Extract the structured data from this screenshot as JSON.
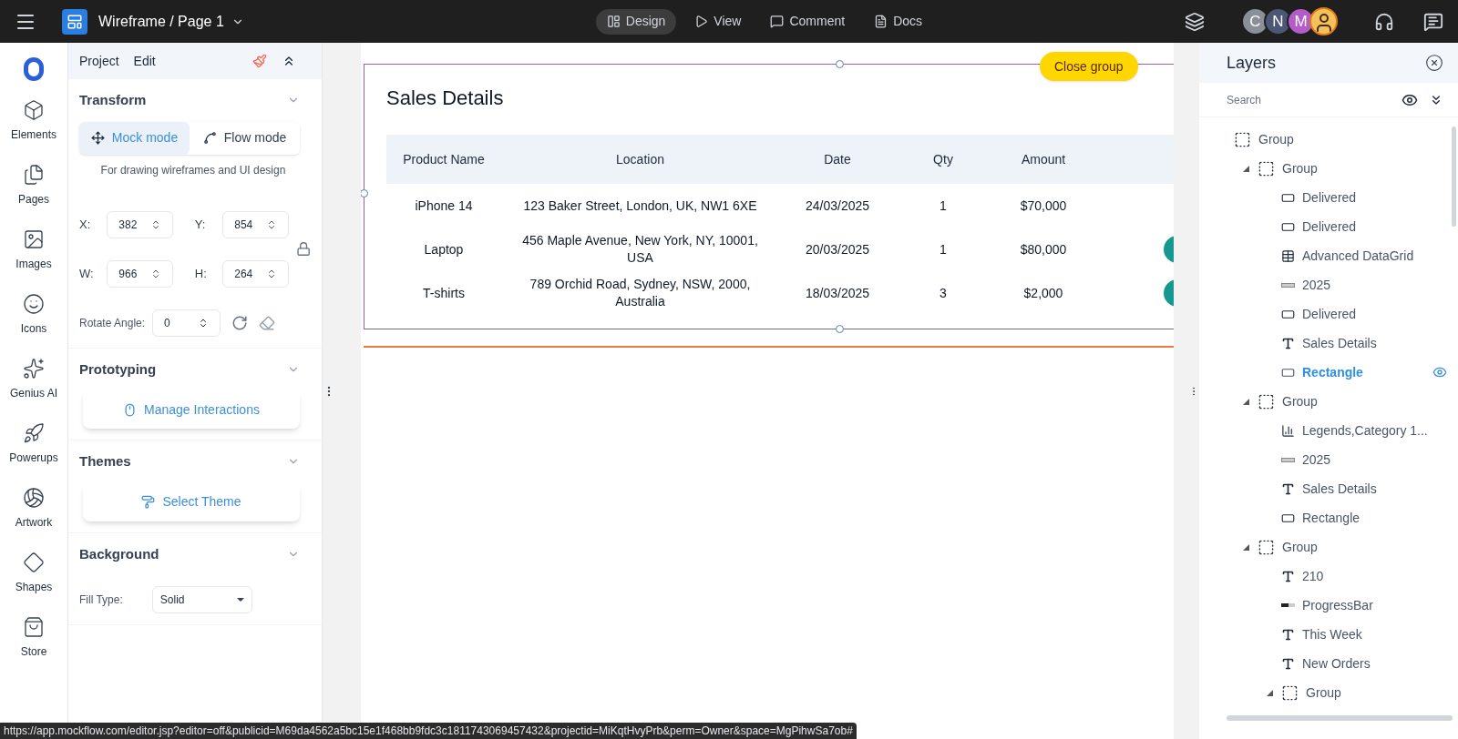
{
  "topbar": {
    "file_title": "Wireframe / Page 1",
    "modes": [
      {
        "label": "Design",
        "selected": true
      },
      {
        "label": "View",
        "selected": false
      },
      {
        "label": "Comment",
        "selected": false
      },
      {
        "label": "Docs",
        "selected": false
      }
    ],
    "avatars": [
      {
        "kind": "letter",
        "label": "C",
        "color": "#8a8f98"
      },
      {
        "kind": "letter",
        "label": "N",
        "color": "#4c5675"
      },
      {
        "kind": "letter",
        "label": "M",
        "color": "#b35bc9"
      },
      {
        "kind": "photo"
      }
    ]
  },
  "rail": {
    "items": [
      {
        "label": "Elements",
        "kind": "cube"
      },
      {
        "label": "Pages",
        "kind": "pages"
      },
      {
        "label": "Images",
        "kind": "image"
      },
      {
        "label": "Icons",
        "kind": "smile"
      },
      {
        "label": "Genius AI",
        "kind": "sparkles"
      },
      {
        "label": "Powerups",
        "kind": "rocket"
      },
      {
        "label": "Artwork",
        "kind": "ball"
      },
      {
        "label": "Shapes",
        "kind": "diamond"
      },
      {
        "label": "Store",
        "kind": "bag"
      }
    ]
  },
  "properties": {
    "menu": [
      "Project",
      "Edit"
    ],
    "transform": {
      "title": "Transform",
      "modes": [
        {
          "label": "Mock mode",
          "selected": true
        },
        {
          "label": "Flow mode",
          "selected": false
        }
      ],
      "hint": "For drawing wireframes and UI design",
      "fields": [
        {
          "label": "X:",
          "value": "382"
        },
        {
          "label": "Y:",
          "value": "854"
        },
        {
          "label": "W:",
          "value": "966"
        },
        {
          "label": "H:",
          "value": "264"
        }
      ],
      "rotate_label": "Rotate Angle:",
      "rotate_value": "0"
    },
    "prototyping": {
      "title": "Prototyping",
      "button": "Manage Interactions"
    },
    "themes": {
      "title": "Themes",
      "button": "Select Theme"
    },
    "background": {
      "title": "Background",
      "fill_label": "Fill Type:",
      "fill_value": "Solid"
    }
  },
  "canvas": {
    "close_group": "Close group",
    "card_title": "Sales Details",
    "table": {
      "columns": [
        "Product Name",
        "Location",
        "Date",
        "Qty",
        "Amount"
      ],
      "rows": [
        {
          "cells": [
            "iPhone 14",
            "123 Baker Street, London, UK, NW1 6XE",
            "24/03/2025",
            "1",
            "$70,000"
          ],
          "badge": false
        },
        {
          "cells": [
            "Laptop",
            "456 Maple Avenue, New York, NY, 10001, USA",
            "20/03/2025",
            "1",
            "$80,000"
          ],
          "badge": true
        },
        {
          "cells": [
            "T-shirts",
            "789 Orchid Road, Sydney, NSW, 2000, Australia",
            "18/03/2025",
            "3",
            "$2,000"
          ],
          "badge": true
        }
      ]
    }
  },
  "layers": {
    "title": "Layers",
    "search_placeholder": "Search",
    "items": [
      {
        "label": "Group",
        "kind": "group",
        "selected": false,
        "expanded": true,
        "children": [
          {
            "label": "Group",
            "kind": "group",
            "selected": false,
            "expanded": true,
            "children": [
              {
                "label": "Delivered",
                "kind": "button",
                "selected": false
              },
              {
                "label": "Delivered",
                "kind": "button",
                "selected": false
              },
              {
                "label": "Advanced DataGrid",
                "kind": "grid",
                "selected": false
              },
              {
                "label": "2025",
                "kind": "input",
                "selected": false
              },
              {
                "label": "Delivered",
                "kind": "button",
                "selected": false
              },
              {
                "label": "Sales Details",
                "kind": "text",
                "selected": false
              },
              {
                "label": "Rectangle",
                "kind": "rect",
                "selected": true
              }
            ]
          },
          {
            "label": "Group",
            "kind": "group",
            "selected": false,
            "expanded": true,
            "children": [
              {
                "label": "Legends,Category 1...",
                "kind": "chart",
                "selected": false
              },
              {
                "label": "2025",
                "kind": "input",
                "selected": false
              },
              {
                "label": "Sales Details",
                "kind": "text",
                "selected": false
              },
              {
                "label": "Rectangle",
                "kind": "rect",
                "selected": false
              }
            ]
          },
          {
            "label": "Group",
            "kind": "group",
            "selected": false,
            "expanded": true,
            "children": [
              {
                "label": "210",
                "kind": "text",
                "selected": false
              },
              {
                "label": "ProgressBar",
                "kind": "progress",
                "selected": false
              },
              {
                "label": "This Week",
                "kind": "text",
                "selected": false
              },
              {
                "label": "New Orders",
                "kind": "text",
                "selected": false
              },
              {
                "label": "Group",
                "kind": "group",
                "selected": false,
                "expanded": true
              }
            ]
          }
        ]
      }
    ]
  },
  "status_url": "https://app.mockflow.com/editor.jsp?editor=off&publicid=M69da4562a5bc15e1f468bb9fdc3c1811743069457432&projectid=MiKqtHvyPrb&perm=Owner&space=MgPihwSa7ob#"
}
